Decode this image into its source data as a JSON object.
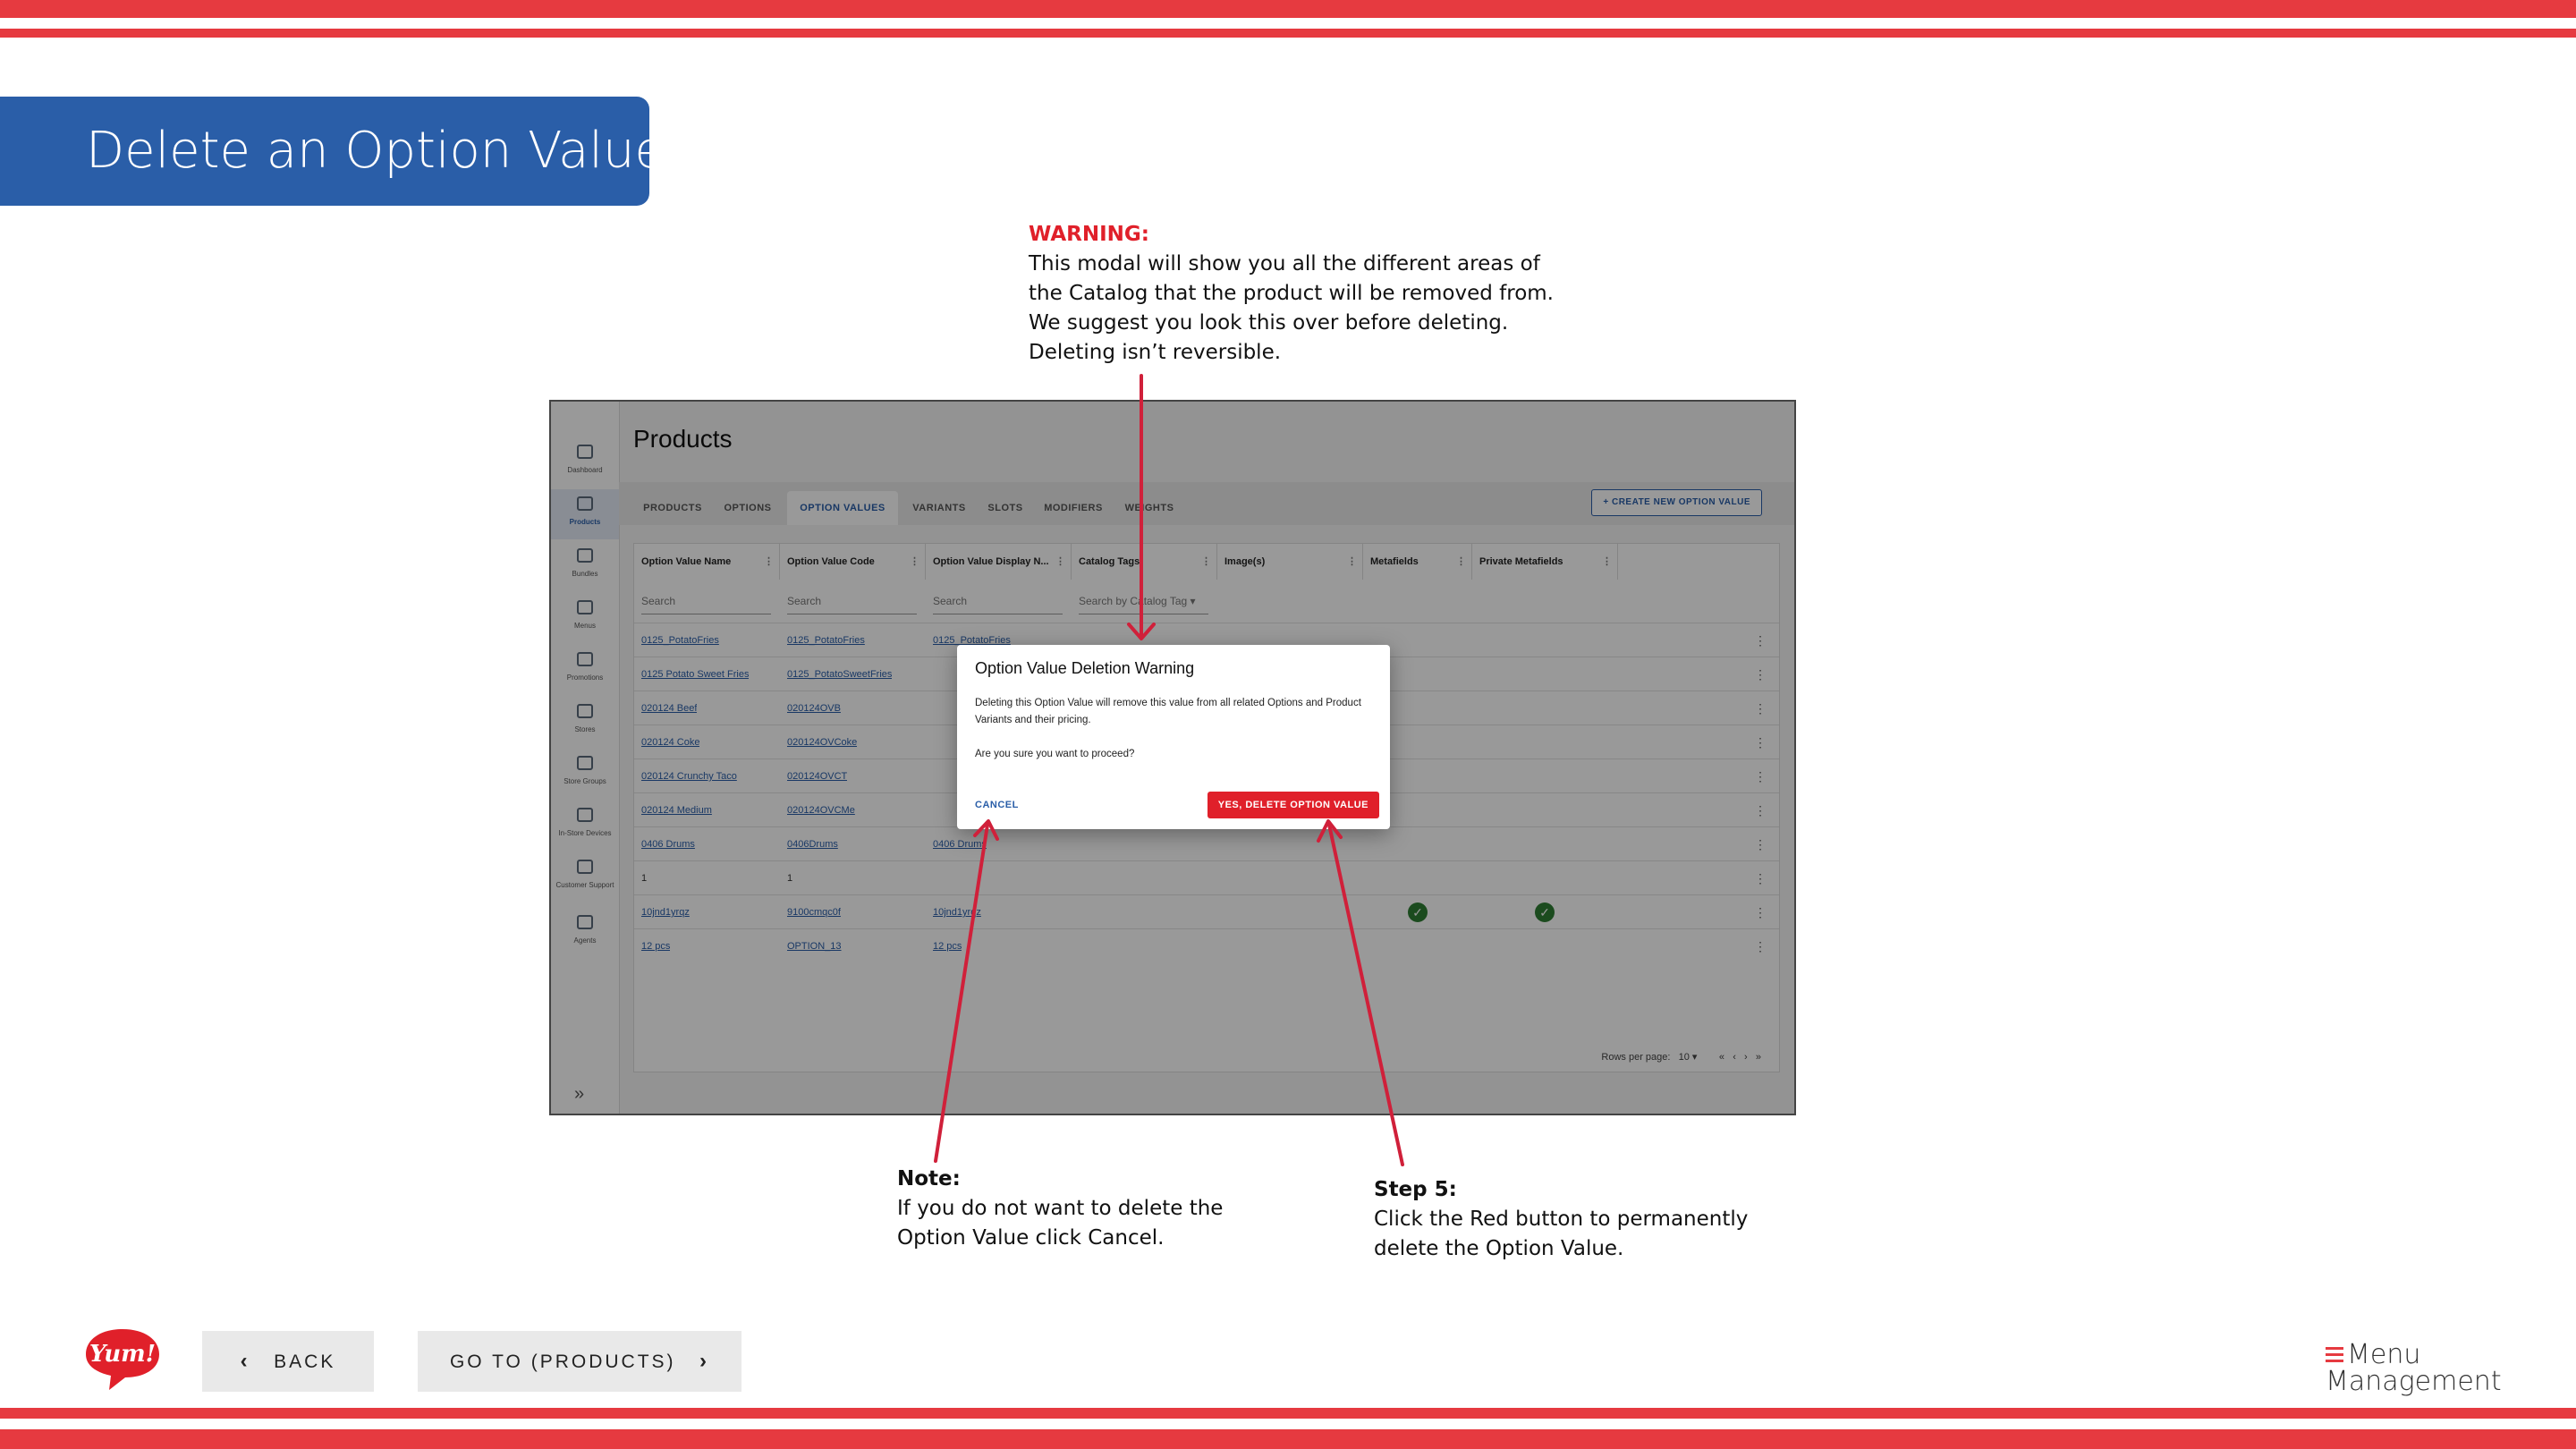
{
  "slide": {
    "title": "Delete an Option Value"
  },
  "callouts": {
    "warning": {
      "heading": "WARNING:",
      "lines": [
        "This modal will show you all the different areas of",
        "the Catalog that the product will be removed from.",
        "We suggest you look this over before deleting.",
        "Deleting isn’t reversible."
      ]
    },
    "note": {
      "heading": "Note:",
      "lines": [
        "If you do not want to delete the",
        "Option Value click Cancel."
      ]
    },
    "step": {
      "heading": "Step 5:",
      "lines": [
        "Click the Red button to permanently",
        "delete the Option Value."
      ]
    }
  },
  "app": {
    "page_title": "Products",
    "nav": [
      {
        "label": "Dashboard",
        "icon": "home-icon"
      },
      {
        "label": "Products",
        "icon": "box-icon",
        "active": true
      },
      {
        "label": "Bundles",
        "icon": "cube-icon"
      },
      {
        "label": "Menus",
        "icon": "document-icon"
      },
      {
        "label": "Promotions",
        "icon": "tag-icon"
      },
      {
        "label": "Stores",
        "icon": "store-icon"
      },
      {
        "label": "Store Groups",
        "icon": "grid-icon"
      },
      {
        "label": "In-Store Devices",
        "icon": "monitor-icon"
      },
      {
        "label": "Customer Support",
        "icon": "support-icon"
      },
      {
        "label": "Agents",
        "icon": "people-icon"
      }
    ],
    "tabs": [
      "PRODUCTS",
      "OPTIONS",
      "OPTION VALUES",
      "VARIANTS",
      "SLOTS",
      "MODIFIERS",
      "WEIGHTS"
    ],
    "active_tab": "OPTION VALUES",
    "create_button": "+ CREATE NEW OPTION VALUE",
    "columns": [
      "Option Value Name",
      "Option Value Code",
      "Option Value Display N...",
      "Catalog Tags",
      "Image(s)",
      "Metafields",
      "Private Metafields"
    ],
    "filters": {
      "search1": "Search",
      "search2": "Search",
      "search3": "Search",
      "catalog_tag": "Search by Catalog Tag"
    },
    "rows": [
      {
        "name": "0125_PotatoFries",
        "code": "0125_PotatoFries",
        "display": "0125_PotatoFries"
      },
      {
        "name": "0125 Potato Sweet Fries",
        "code": "0125_PotatoSweetFries",
        "display": ""
      },
      {
        "name": "020124 Beef",
        "code": "020124OVB",
        "display": ""
      },
      {
        "name": "020124 Coke",
        "code": "020124OVCoke",
        "display": ""
      },
      {
        "name": "020124 Crunchy Taco",
        "code": "020124OVCT",
        "display": ""
      },
      {
        "name": "020124 Medium",
        "code": "020124OVCMe",
        "display": ""
      },
      {
        "name": "0406 Drums",
        "code": "0406Drums",
        "display": "0406 Drums"
      },
      {
        "name": "1",
        "code": "1",
        "display": ""
      },
      {
        "name": "10jnd1yrqz",
        "code": "9100cmqc0f",
        "display": "10jnd1yrqz",
        "metafields": true,
        "private": true
      },
      {
        "name": "12 pcs",
        "code": "OPTION_13",
        "display": "12 pcs"
      }
    ],
    "pager": {
      "rows_label": "Rows per page:",
      "rows_value": "10"
    }
  },
  "modal": {
    "title": "Option Value Deletion Warning",
    "body1": "Deleting this Option Value will remove this value from all related Options and Product Variants and their pricing.",
    "body2": "Are you sure you want to proceed?",
    "cancel": "CANCEL",
    "confirm": "YES, DELETE OPTION VALUE"
  },
  "footer": {
    "back": "BACK",
    "goto": "GO TO (PRODUCTS)",
    "yum_logo_text": "Yum!",
    "brand_line1": "Menu",
    "brand_line2": "Management"
  },
  "colors": {
    "stripe": "#e63a40",
    "title_bg": "#2a5ea8",
    "warning_text": "#e0202a",
    "confirm_button": "#e0202a",
    "arrow": "#d0203a"
  }
}
